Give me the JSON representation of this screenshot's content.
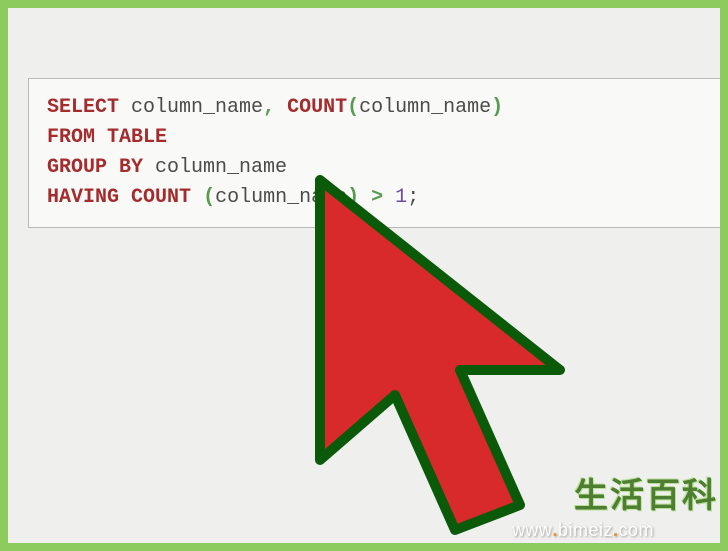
{
  "code": {
    "l1": {
      "kw_select": "SELECT",
      "sp1": " ",
      "id1": "column_name",
      "comma": ",",
      "sp2": " ",
      "fn_count": "COUNT",
      "lp": "(",
      "id2": "column_name",
      "rp": ")"
    },
    "l2": {
      "kw_from": "FROM",
      "sp1": " ",
      "kw_table": "TABLE"
    },
    "l3": {
      "kw_group": "GROUP BY",
      "sp1": " ",
      "id1": "column_name"
    },
    "l4": {
      "kw_having": "HAVING",
      "sp1": " ",
      "fn_count": "COUNT",
      "sp2": " ",
      "lp": "(",
      "id1": "column_name",
      "rp": ")",
      "sp3": " ",
      "op_gt": ">",
      "sp4": " ",
      "num1": "1",
      "semi": ";"
    }
  },
  "watermark": {
    "cn": "生活百科",
    "url_pre": "www",
    "url_mid": "bimeiz",
    "url_suf": "com",
    "dot": "."
  }
}
